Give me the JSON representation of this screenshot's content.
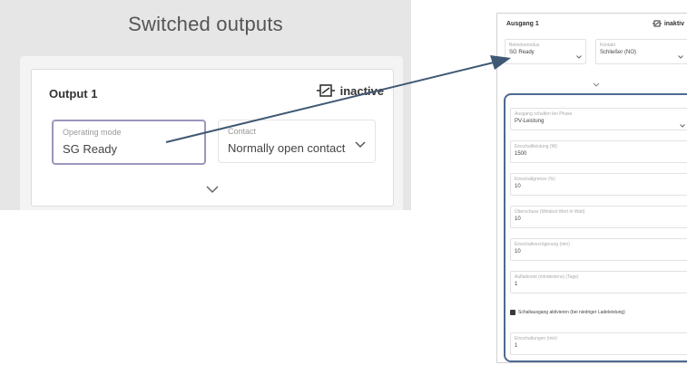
{
  "left": {
    "title": "Switched outputs",
    "output": {
      "label": "Output 1",
      "status": "inactive",
      "operating_mode": {
        "label": "Operating mode",
        "value": "SG Ready"
      },
      "contact": {
        "label": "Contact",
        "value": "Normally open contact (N"
      }
    },
    "icons": [
      "output-status-icon",
      "chevron-down-icon",
      "expand-chevron-icon"
    ]
  },
  "right": {
    "title": "Ausgang 1",
    "status": "inaktiv",
    "operating_mode": {
      "label": "Betriebsmodus",
      "value": "SG Ready"
    },
    "contact": {
      "label": "Kontakt",
      "value": "Schließer (NO)"
    },
    "fields": [
      {
        "label": "Ausgang schalten bei Phase",
        "value": "PV-Leistung"
      },
      {
        "label": "Einschaltleistung (W)",
        "value": "1500"
      },
      {
        "label": "Einschaltgrenze (%)",
        "value": "10"
      },
      {
        "label": "Überschuss (Mindest-Wert in Watt)",
        "value": "10"
      },
      {
        "label": "Einschaltverzögerung (min)",
        "value": "10"
      },
      {
        "label": "Aufladezeit (mindestens) (Tage)",
        "value": "1"
      }
    ],
    "checkbox_label": "Schaltausgang aktivieren (bei niedriger Ladeleistung)",
    "last_field": {
      "label": "Einschaltungen (min)",
      "value": "1"
    }
  },
  "colors": {
    "accent_border": "#9c96bd",
    "arrow": "#3f5875",
    "highlight_box": "#4d6a8f"
  }
}
